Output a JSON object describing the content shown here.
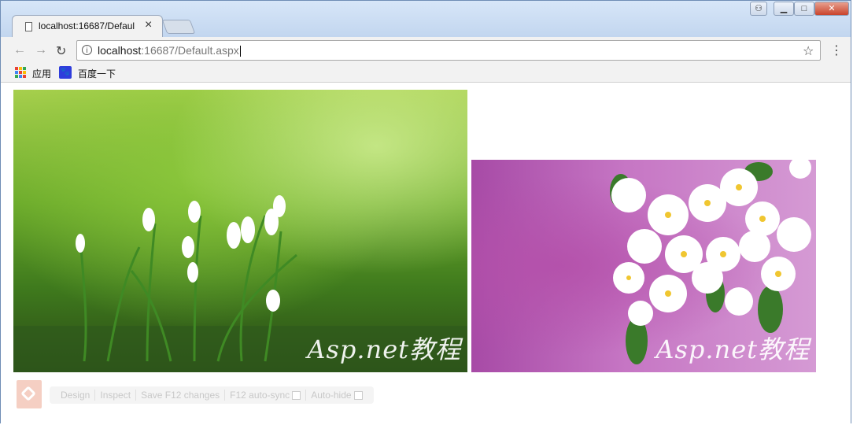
{
  "browser": {
    "tab": {
      "title": "localhost:16687/Defaul",
      "close": "×"
    },
    "window_buttons": {
      "user": "⚇",
      "minimize": "▁",
      "maximize": "□",
      "close": "✕"
    },
    "nav": {
      "back": "←",
      "forward": "→",
      "reload": "↻"
    },
    "address_bar": {
      "host": "localhost",
      "path": ":16687/Default.aspx",
      "info": "i"
    },
    "star": "☆",
    "menu": "⋮"
  },
  "bookmarks": [
    {
      "label": "应用",
      "icon": "apps-grid-icon"
    },
    {
      "label": "百度一下",
      "icon": "baidu-paw-icon"
    }
  ],
  "page": {
    "images": [
      {
        "name": "snowdrop-flowers-image",
        "watermark": "Asp.net教程"
      },
      {
        "name": "apple-blossom-image",
        "watermark": "Asp.net教程"
      }
    ],
    "vs_toolbar": {
      "design": "Design",
      "inspect": "Inspect",
      "save": "Save F12 changes",
      "autosync": "F12 auto-sync",
      "autohide": "Auto-hide"
    }
  },
  "colors": {
    "apps_icon": [
      "#e94235",
      "#fbbc05",
      "#34a853",
      "#4285f4",
      "#e94235",
      "#fbbc05",
      "#34a853",
      "#4285f4",
      "#e94235"
    ],
    "baidu": "#2f3ddc"
  }
}
